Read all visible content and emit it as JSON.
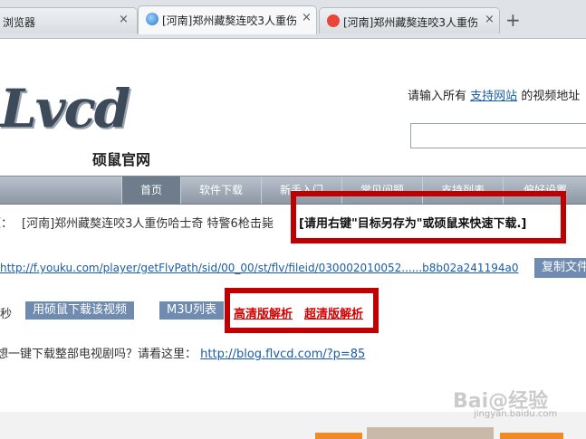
{
  "tabs": [
    {
      "title": "浏览器",
      "close": "×"
    },
    {
      "title": "[河南]郑州藏獒连咬3人重伤",
      "close": "×"
    },
    {
      "title": "[河南]郑州藏獒连咬3人重伤",
      "close": "×"
    }
  ],
  "new_tab": "+",
  "logo": {
    "text": "Lvcd",
    "subtitle": "硕鼠官网"
  },
  "hint": {
    "prefix": "请输入所有",
    "link": "支持网站",
    "suffix": "的视频地址"
  },
  "nav": [
    "首页",
    "软件下载",
    "新手入门",
    "常见问题",
    "支持列表",
    "偏好设置"
  ],
  "result": {
    "title_label": "题：",
    "title": "[河南]郑州藏獒连咬3人重伤哈士奇 特警6枪击毙",
    "tip": "[请用右键\"目标另存为\"或硕鼠来快速下载.]",
    "url": "http://f.youku.com/player/getFlvPath/sid/00_00/st/flv/fileid/030002010052......b8b02a241194a0",
    "copy_button": "复制文件",
    "row_label": "秒",
    "download_button": "用硕鼠下载该视频",
    "m3u_button": "M3U列表",
    "hd_link": "高清版解析",
    "super_hd_link": "超清版解析",
    "promo_text": "想一键下载整部电视剧吗？请看这里：",
    "promo_link": "http://blog.flvcd.com/?p=85"
  },
  "watermark": {
    "text": "Bai@经验",
    "url": "jingyan.baidu.com"
  },
  "colors": {
    "highlight_box": "#c00000",
    "link": "#1a5ca8",
    "button": "#6f8bb0",
    "red_link": "#d40000"
  }
}
